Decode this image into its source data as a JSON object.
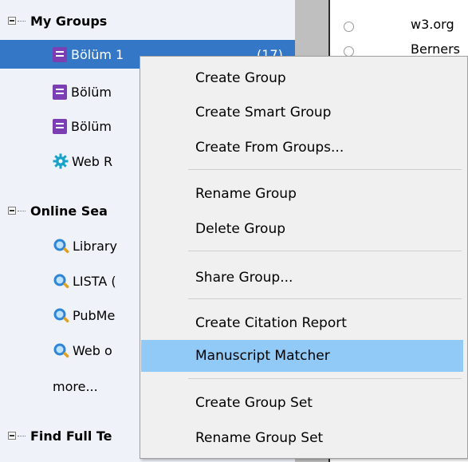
{
  "sidebar": {
    "my_groups": {
      "label": "My Groups",
      "items": [
        {
          "label": "Bölüm 1",
          "count": "(17)",
          "icon": "book-icon"
        },
        {
          "label": "Bölüm",
          "icon": "book-icon"
        },
        {
          "label": "Bölüm",
          "icon": "book-icon"
        },
        {
          "label": "Web R",
          "icon": "gear-icon"
        }
      ]
    },
    "online_search": {
      "label": "Online Sea",
      "items": [
        {
          "label": "Library",
          "icon": "search-globe-icon"
        },
        {
          "label": "LISTA (",
          "icon": "search-globe-icon"
        },
        {
          "label": "PubMe",
          "icon": "search-globe-icon"
        },
        {
          "label": "Web o",
          "icon": "search-globe-icon"
        }
      ],
      "more_label": "more..."
    },
    "find_full_text": {
      "label": "Find Full Te"
    }
  },
  "right_pane": {
    "rows": [
      "w3.org",
      "Berners"
    ]
  },
  "context_menu": {
    "items": [
      "Create Group",
      "Create Smart Group",
      "Create From Groups...",
      "Rename Group",
      "Delete Group",
      "Share Group...",
      "Create Citation Report",
      "Manuscript Matcher",
      "Create Group Set",
      "Rename Group Set"
    ],
    "highlighted": "Manuscript Matcher"
  },
  "colors": {
    "selection": "#3377c6",
    "menu_highlight": "#91c9f7",
    "menu_background": "#f0f0f0",
    "sidebar_background": "#eff2f8",
    "book_icon": "#7b3fb3"
  }
}
